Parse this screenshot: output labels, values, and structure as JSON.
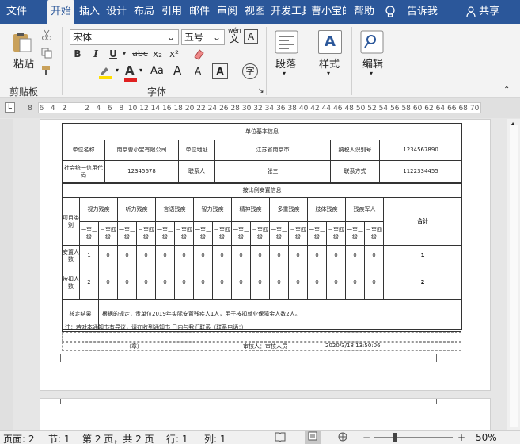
{
  "tabs": [
    "文件",
    "开始",
    "插入",
    "设计",
    "布局",
    "引用",
    "邮件",
    "审阅",
    "视图",
    "开发工具",
    "曹小宝的",
    "帮助",
    "告诉我",
    "共享"
  ],
  "ribbon": {
    "paste": "粘贴",
    "clipboard": "剪贴板",
    "font_name": "宋体",
    "font_size": "五号",
    "wen": "wén",
    "wen2": "文",
    "A_box": "A",
    "bold": "B",
    "italic": "I",
    "underline": "U",
    "strike": "abc",
    "sub": "x₂",
    "sup": "x²",
    "font_color_a": "A",
    "aa": "Aa",
    "a_up": "A",
    "a_down": "A",
    "circle_char": "字",
    "font_group": "字体",
    "paragraph": "段落",
    "styles": "样式",
    "editing": "编辑",
    "fmt_a": "A"
  },
  "ruler_ticks": [
    "8",
    "6",
    "4",
    "2",
    "",
    "2",
    "4",
    "6",
    "8",
    "10",
    "12",
    "14",
    "16",
    "18",
    "20",
    "22",
    "24",
    "26",
    "28",
    "30",
    "32",
    "34",
    "36",
    "38",
    "40",
    "42",
    "44",
    "46",
    "48",
    "50",
    "52",
    "54",
    "56",
    "58",
    "60",
    "62",
    "64",
    "66",
    "68",
    "70"
  ],
  "ruler_l": "L",
  "table": {
    "basic_title": "单位基本信息",
    "unit_name_label": "单位名称",
    "unit_name": "南京曹小宝有限公司",
    "addr_label": "单位地址",
    "addr": "江苏省南京市",
    "tax_label": "纳税人识别号",
    "tax": "1234567890",
    "credit_label": "社会统一信用代码",
    "credit": "12345678",
    "contact_label": "联系人",
    "contact": "张三",
    "phone_label": "联系方式",
    "phone": "1122334455",
    "ratio_title": "按比例安置信息",
    "item_label": "项目类别",
    "categories": [
      "视力残疾",
      "听力残疾",
      "言语残疾",
      "智力残疾",
      "精神残疾",
      "多重残疾",
      "肢体残疾",
      "残疾军人"
    ],
    "grade_a": "一至二级",
    "grade_b": "三至四级",
    "total_label": "合计",
    "row1_label": "安置人数",
    "row1_values": [
      "1",
      "0",
      "0",
      "0",
      "0",
      "0",
      "0",
      "0",
      "0",
      "0",
      "0",
      "0",
      "0",
      "0",
      "0",
      "0"
    ],
    "row1_total": "1",
    "row2_label": "按扣人数",
    "row2_values": [
      "2",
      "0",
      "0",
      "0",
      "0",
      "0",
      "0",
      "0",
      "0",
      "0",
      "0",
      "0",
      "0",
      "0",
      "0",
      "0"
    ],
    "row2_total": "2",
    "note_label": "核定结果",
    "note": "根据的规定，贵单位2019年实际安置残疾人1人，用于按扣就业保障金人数2人。",
    "footer_note": "注：若对本通知书有异议，请在收到通知书 日内与我们联系（联系电话：）",
    "seal": "（章）",
    "reviewer": "审核人：审核人员",
    "date": "2020/3/18 13:50:06"
  },
  "status": {
    "page": "页面: 2",
    "section": "节: 1",
    "pages": "第 2 页，共 2 页",
    "row": "行: 1",
    "col": "列: 1",
    "zoom": "50%"
  }
}
